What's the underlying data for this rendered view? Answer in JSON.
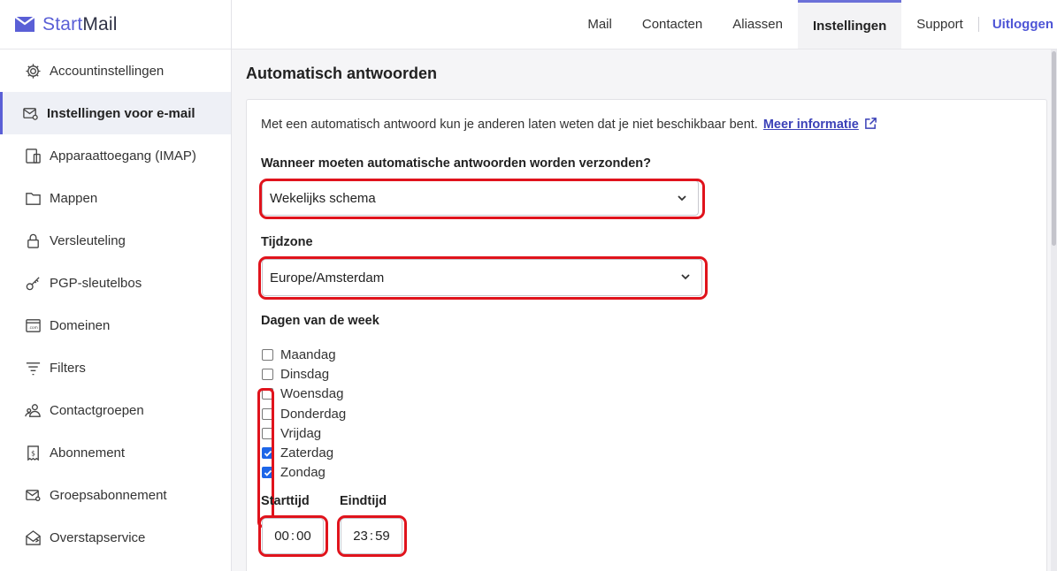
{
  "brand": {
    "name_part1": "Start",
    "name_part2": "Mail",
    "accent": "#5a5fd6"
  },
  "topnav": {
    "tabs": [
      {
        "label": "Mail",
        "active": false
      },
      {
        "label": "Contacten",
        "active": false
      },
      {
        "label": "Aliassen",
        "active": false
      },
      {
        "label": "Instellingen",
        "active": true
      },
      {
        "label": "Support",
        "active": false
      }
    ],
    "logout_label": "Uitloggen"
  },
  "sidebar": {
    "items": [
      {
        "label": "Accountinstellingen",
        "icon": "gear-icon",
        "active": false
      },
      {
        "label": "Instellingen voor e-mail",
        "icon": "mail-settings-icon",
        "active": true
      },
      {
        "label": "Apparaattoegang (IMAP)",
        "icon": "device-icon",
        "active": false
      },
      {
        "label": "Mappen",
        "icon": "folder-icon",
        "active": false
      },
      {
        "label": "Versleuteling",
        "icon": "lock-icon",
        "active": false
      },
      {
        "label": "PGP-sleutelbos",
        "icon": "key-icon",
        "active": false
      },
      {
        "label": "Domeinen",
        "icon": "domain-icon",
        "active": false
      },
      {
        "label": "Filters",
        "icon": "filter-icon",
        "active": false
      },
      {
        "label": "Contactgroepen",
        "icon": "contact-groups-icon",
        "active": false
      },
      {
        "label": "Abonnement",
        "icon": "receipt-icon",
        "active": false
      },
      {
        "label": "Groepsabonnement",
        "icon": "group-mail-icon",
        "active": false
      },
      {
        "label": "Overstapservice",
        "icon": "transfer-icon",
        "active": false
      }
    ]
  },
  "main": {
    "title": "Automatisch antwoorden",
    "intro_text": "Met een automatisch antwoord kun je anderen laten weten dat je niet beschikbaar bent.",
    "more_info_label": "Meer informatie",
    "when_label": "Wanneer moeten automatische antwoorden worden verzonden?",
    "when_value": "Wekelijks schema",
    "timezone_label": "Tijdzone",
    "timezone_value": "Europe/Amsterdam",
    "days_label": "Dagen van de week",
    "days": [
      {
        "label": "Maandag",
        "checked": false
      },
      {
        "label": "Dinsdag",
        "checked": false
      },
      {
        "label": "Woensdag",
        "checked": false
      },
      {
        "label": "Donderdag",
        "checked": false
      },
      {
        "label": "Vrijdag",
        "checked": false
      },
      {
        "label": "Zaterdag",
        "checked": true
      },
      {
        "label": "Zondag",
        "checked": true
      }
    ],
    "start_label": "Starttijd",
    "start_hours": "00",
    "start_minutes": "00",
    "end_label": "Eindtijd",
    "end_hours": "23",
    "end_minutes": "59"
  },
  "colors": {
    "highlight": "#e0131c",
    "checkbox": "#1e66e8",
    "link": "#3b41b8"
  }
}
